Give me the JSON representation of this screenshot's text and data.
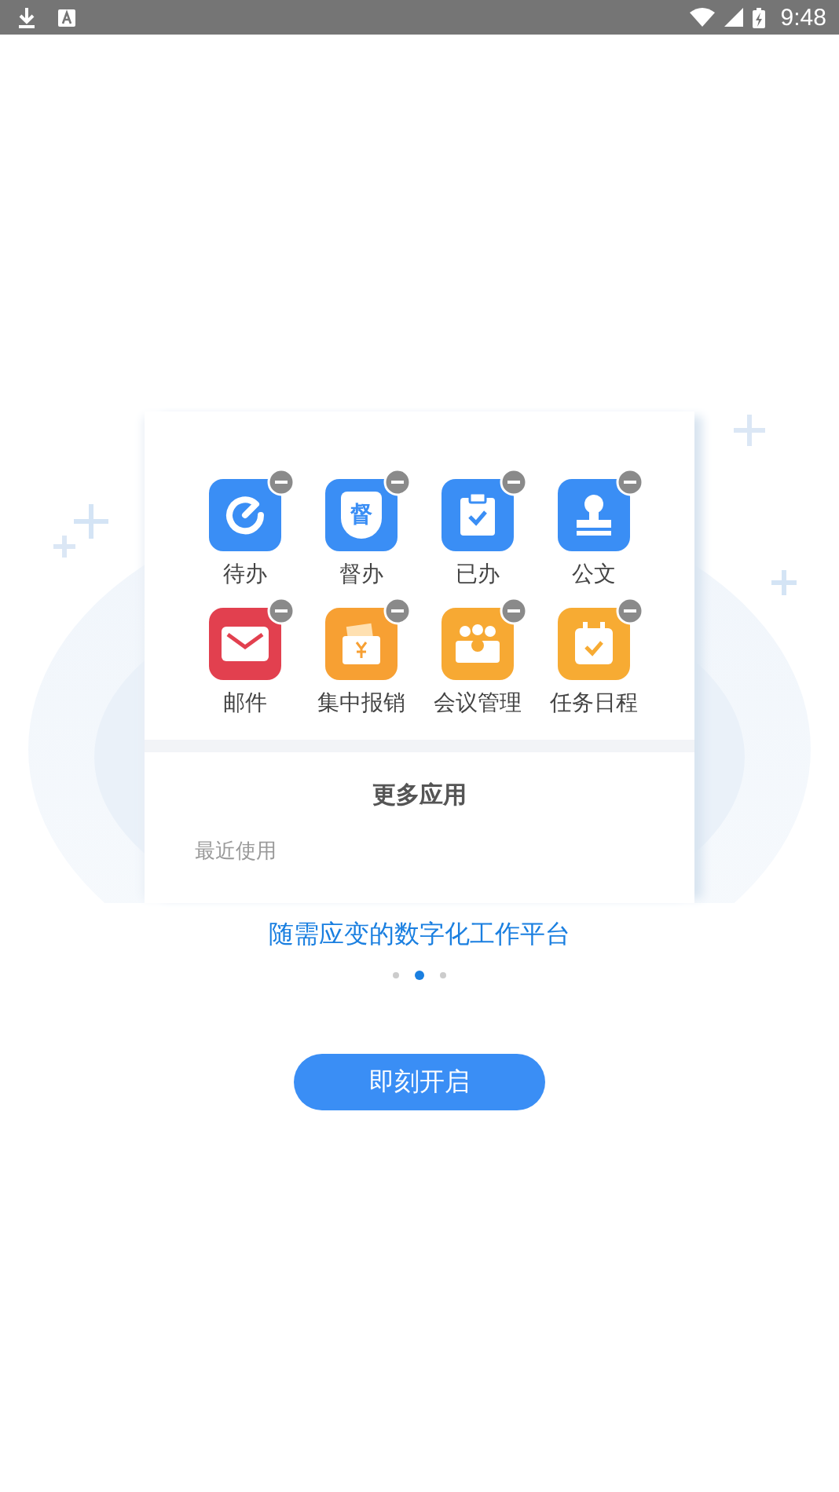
{
  "status_bar": {
    "time": "9:48"
  },
  "apps": [
    {
      "label": "待办",
      "kind": "timer",
      "color": "#3a8ef5",
      "removable": true
    },
    {
      "label": "督办",
      "kind": "shield",
      "color": "#3a8ef5",
      "glyph": "督",
      "removable": true
    },
    {
      "label": "已办",
      "kind": "clipboard",
      "color": "#3a8ef5",
      "removable": true
    },
    {
      "label": "公文",
      "kind": "stamp",
      "color": "#3a8ef5",
      "removable": true
    },
    {
      "label": "邮件",
      "kind": "mail",
      "color": "#e2404f",
      "removable": true
    },
    {
      "label": "集中报销",
      "kind": "wallet",
      "color": "#f7a033",
      "removable": true
    },
    {
      "label": "会议管理",
      "kind": "meeting",
      "color": "#f7a933",
      "removable": true
    },
    {
      "label": "任务日程",
      "kind": "calendar",
      "color": "#f7ab33",
      "removable": true
    }
  ],
  "more_title": "更多应用",
  "recent_label": "最近使用",
  "tagline": "随需应变的数字化工作平台",
  "pager": [
    {
      "selected": false
    },
    {
      "selected": true
    },
    {
      "selected": false
    }
  ],
  "start_button": "即刻开启"
}
